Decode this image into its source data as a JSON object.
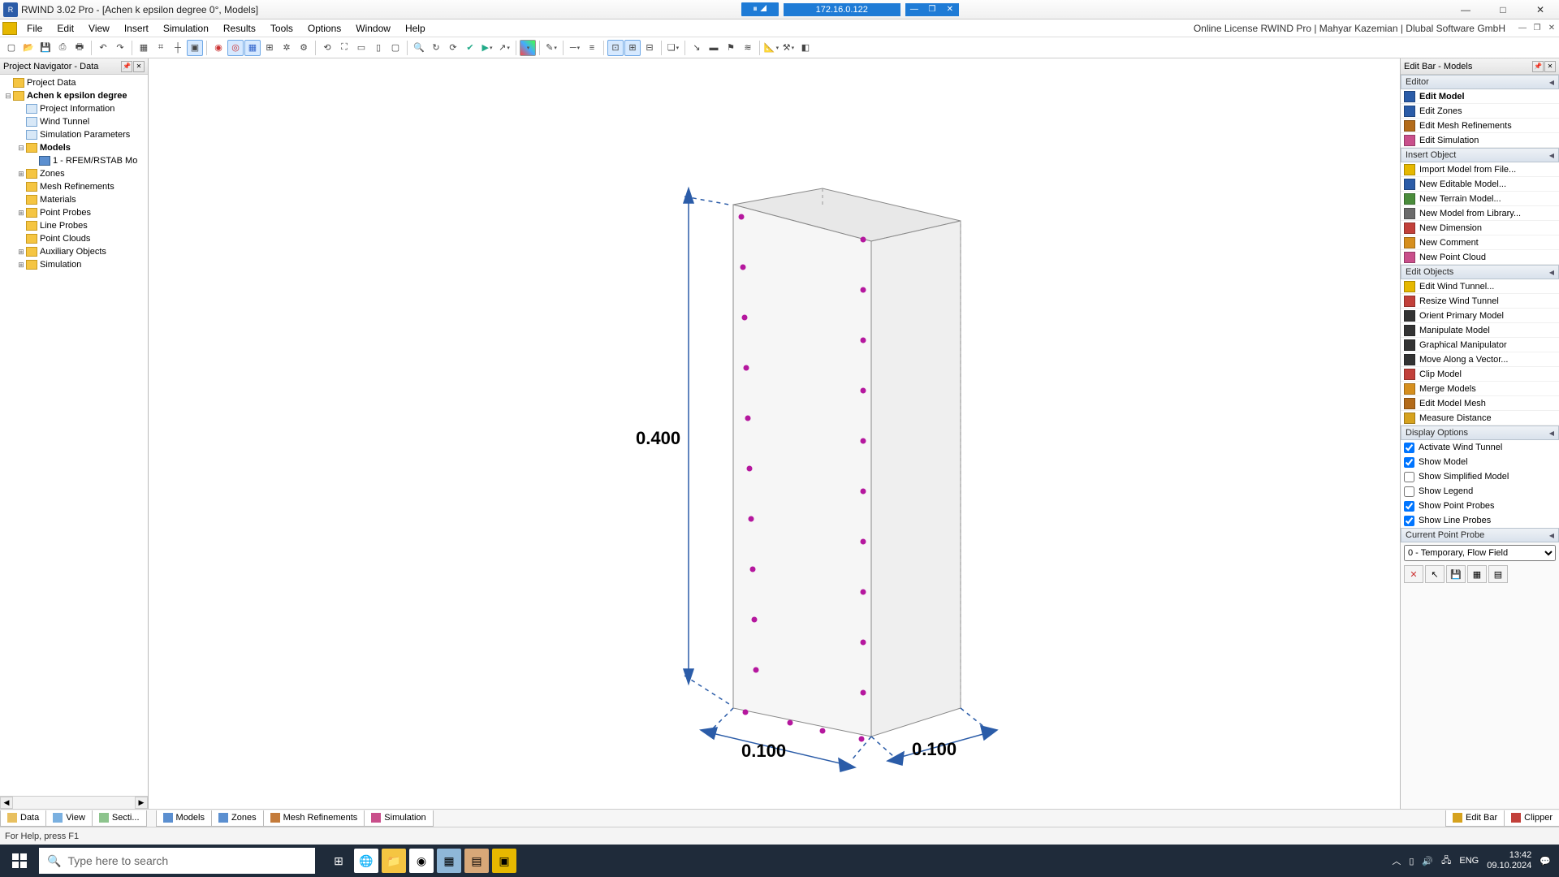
{
  "titlebar": {
    "app": "RWIND 3.02 Pro",
    "doc": "[Achen  k epsilon degree 0°, Models]",
    "ip": "172.16.0.122"
  },
  "menu": {
    "items": [
      "File",
      "Edit",
      "View",
      "Insert",
      "Simulation",
      "Results",
      "Tools",
      "Options",
      "Window",
      "Help"
    ],
    "license": "Online License RWIND Pro | Mahyar Kazemian | Dlubal Software GmbH"
  },
  "navigator": {
    "title": "Project Navigator - Data",
    "nodes": [
      {
        "depth": 0,
        "exp": "",
        "ic": "folder",
        "label": "Project Data"
      },
      {
        "depth": 0,
        "exp": "−",
        "ic": "folder",
        "label": "Achen  k epsilon degree",
        "bold": true
      },
      {
        "depth": 1,
        "exp": "",
        "ic": "doc",
        "label": "Project Information"
      },
      {
        "depth": 1,
        "exp": "",
        "ic": "doc",
        "label": "Wind Tunnel"
      },
      {
        "depth": 1,
        "exp": "",
        "ic": "doc",
        "label": "Simulation Parameters"
      },
      {
        "depth": 1,
        "exp": "−",
        "ic": "folder",
        "label": "Models",
        "bold": true
      },
      {
        "depth": 2,
        "exp": "",
        "ic": "model",
        "label": "1 - RFEM/RSTAB Mo"
      },
      {
        "depth": 1,
        "exp": "+",
        "ic": "folder",
        "label": "Zones"
      },
      {
        "depth": 1,
        "exp": "",
        "ic": "folder",
        "label": "Mesh Refinements"
      },
      {
        "depth": 1,
        "exp": "",
        "ic": "folder",
        "label": "Materials"
      },
      {
        "depth": 1,
        "exp": "+",
        "ic": "folder",
        "label": "Point Probes"
      },
      {
        "depth": 1,
        "exp": "",
        "ic": "folder",
        "label": "Line Probes"
      },
      {
        "depth": 1,
        "exp": "",
        "ic": "folder",
        "label": "Point Clouds"
      },
      {
        "depth": 1,
        "exp": "+",
        "ic": "folder",
        "label": "Auxiliary Objects"
      },
      {
        "depth": 1,
        "exp": "+",
        "ic": "folder",
        "label": "Simulation"
      }
    ]
  },
  "editbar": {
    "title": "Edit Bar - Models",
    "sections": {
      "editor": {
        "header": "Editor",
        "items": [
          {
            "label": "Edit Model",
            "bold": true,
            "color": "#2b5ca8"
          },
          {
            "label": "Edit Zones",
            "color": "#2b5ca8"
          },
          {
            "label": "Edit Mesh Refinements",
            "color": "#b36b1a"
          },
          {
            "label": "Edit Simulation",
            "color": "#c94f8b"
          }
        ]
      },
      "insert": {
        "header": "Insert Object",
        "items": [
          {
            "label": "Import Model from File...",
            "color": "#e6b800"
          },
          {
            "label": "New Editable Model...",
            "color": "#2b5ca8"
          },
          {
            "label": "New Terrain Model...",
            "color": "#4a8c3b"
          },
          {
            "label": "New Model from Library...",
            "color": "#6b6b6b"
          },
          {
            "label": "New Dimension",
            "color": "#c2403a"
          },
          {
            "label": "New Comment",
            "color": "#d68f1e"
          },
          {
            "label": "New Point Cloud",
            "color": "#c94f8b"
          }
        ]
      },
      "editobj": {
        "header": "Edit Objects",
        "items": [
          {
            "label": "Edit Wind Tunnel...",
            "color": "#e6b800"
          },
          {
            "label": "Resize Wind Tunnel",
            "color": "#c2403a"
          },
          {
            "label": "Orient Primary Model",
            "color": "#333"
          },
          {
            "label": "Manipulate Model",
            "color": "#333"
          },
          {
            "label": "Graphical Manipulator",
            "color": "#333"
          },
          {
            "label": "Move Along a Vector...",
            "color": "#333"
          },
          {
            "label": "Clip Model",
            "color": "#c2403a"
          },
          {
            "label": "Merge Models",
            "color": "#d68f1e"
          },
          {
            "label": "Edit Model Mesh",
            "color": "#b36b1a"
          },
          {
            "label": "Measure Distance",
            "color": "#d6a21e"
          }
        ]
      },
      "display": {
        "header": "Display Options",
        "checks": [
          {
            "label": "Activate Wind Tunnel",
            "checked": true
          },
          {
            "label": "Show Model",
            "checked": true
          },
          {
            "label": "Show Simplified Model",
            "checked": false
          },
          {
            "label": "Show Legend",
            "checked": false
          },
          {
            "label": "Show Point Probes",
            "checked": true
          },
          {
            "label": "Show Line Probes",
            "checked": true
          }
        ]
      },
      "probe": {
        "header": "Current Point Probe",
        "select": "0 - Temporary, Flow Field"
      }
    }
  },
  "bottomtabs": {
    "left": [
      "Data",
      "View",
      "Secti..."
    ],
    "mid": [
      "Models",
      "Zones",
      "Mesh Refinements",
      "Simulation"
    ],
    "right": [
      "Edit Bar",
      "Clipper"
    ]
  },
  "statusbar": {
    "help": "For Help, press F1"
  },
  "canvas": {
    "dim_height": "0.400",
    "dim_width1": "0.100",
    "dim_width2": "0.100"
  },
  "taskbar": {
    "search": "Type here to search",
    "lang": "ENG",
    "time": "13:42",
    "date": "09.10.2024"
  }
}
